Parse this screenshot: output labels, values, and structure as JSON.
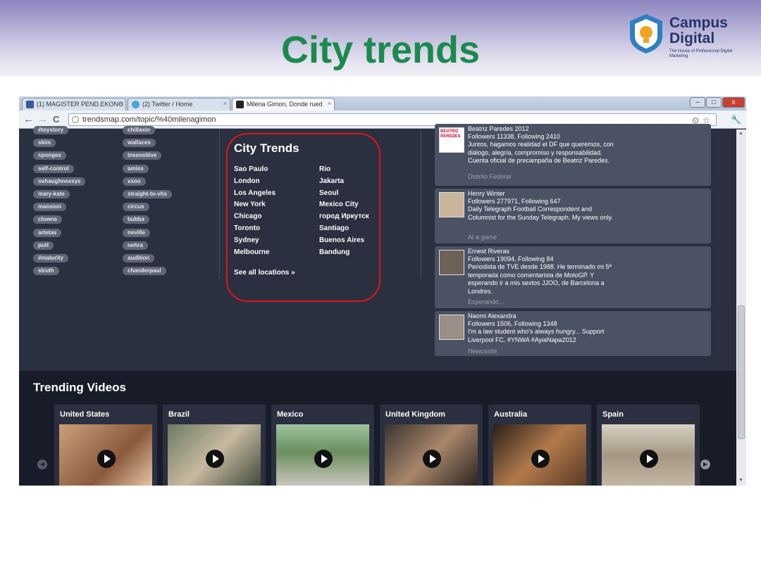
{
  "slide": {
    "title": "City trends",
    "logo": {
      "line1": "Campus",
      "line2": "Digital",
      "tagline": "The House of Professional Digital Marketing"
    }
  },
  "browser": {
    "tabs": [
      {
        "label": "(1) MAGISTER PEND.EKONO",
        "icon": "facebook-icon"
      },
      {
        "label": "(2) Twitter / Home",
        "icon": "twitter-icon"
      },
      {
        "label": "Milena Gimon, Donde rued",
        "icon": "trendsmap-icon"
      }
    ],
    "close_glyph": "×",
    "window_controls": {
      "minimize": "–",
      "maximize": "□",
      "close": "x"
    },
    "back_glyph": "←",
    "forward_glyph": "→",
    "reload_glyph": "C",
    "url": "trendsmap.com/topic/%40milenagimon",
    "star_glyph": "☆",
    "wrench_glyph": "🔧"
  },
  "tags": {
    "left": [
      "#toystory",
      "skim",
      "sponges",
      "self-control",
      "oshaughnessys",
      "mary-kate",
      "mansion",
      "clowns",
      "artetas",
      "putt",
      "#maturity",
      "struth"
    ],
    "right": [
      "chillaxin",
      "wallaces",
      "insensitive",
      "amiss",
      "xxoo",
      "straight-to-vhs",
      "circus",
      "bubba",
      "neville",
      "nehra",
      "audition",
      "chanderpaul"
    ]
  },
  "city_trends": {
    "title": "City Trends",
    "cities_left": [
      "Sao Paulo",
      "London",
      "Los Angeles",
      "New York",
      "Chicago",
      "Toronto",
      "Sydney",
      "Melbourne"
    ],
    "cities_right": [
      "Rio",
      "Jakarta",
      "Seoul",
      "Mexico City",
      "город Иркутск",
      "Santiago",
      "Buenos Aires",
      "Bandung"
    ],
    "see_all": "See all locations »",
    "highlight_color": "#e0141c"
  },
  "tweets": [
    {
      "name": "Beatriz Paredes 2012",
      "stats": "Followers 11338, Following 2410",
      "bio": "Juntos, hagamos realidad el DF que queremos, con diálogo, alegría, compromiso y responsabilidad. Cuenta oficial de precampaña de Beatriz Paredes.",
      "location": "Distrito Federal",
      "avatar_text": "BEATRIZ PAREDES"
    },
    {
      "name": "Henry Winter",
      "stats": "Followers 277971, Following 647",
      "bio": "Daily Telegraph Football Correspondent and Columnist for the Sunday Telegraph. My views only.",
      "location": "At a game",
      "avatar_text": ""
    },
    {
      "name": "Ernest Riveras",
      "stats": "Followers 19094, Following 84",
      "bio": "Periodista de TVE desde 1988. He terminado mi 5ª temporada como comentarista de MotoGP. Y esperando ir a mis sextos JJOO, de Barcelona a Londres.",
      "location": "Esperando...",
      "avatar_text": ""
    },
    {
      "name": "Naomi Alexandra",
      "stats": "Followers 1506, Following 1348",
      "bio": "I'm a law student who's always hungry... Support Liverpool FC. #YNWA #AyiaNapa2012",
      "location": "Newcastle",
      "avatar_text": ""
    }
  ],
  "trending_videos": {
    "title": "Trending Videos",
    "prev_glyph": "◀",
    "next_glyph": "▶",
    "items": [
      {
        "country": "United States"
      },
      {
        "country": "Brazil"
      },
      {
        "country": "Mexico"
      },
      {
        "country": "United Kingdom"
      },
      {
        "country": "Australia"
      },
      {
        "country": "Spain"
      }
    ]
  },
  "colors": {
    "title_green": "#1a8a4e",
    "page_bg": "#2a3040",
    "video_bg": "#171c28"
  }
}
